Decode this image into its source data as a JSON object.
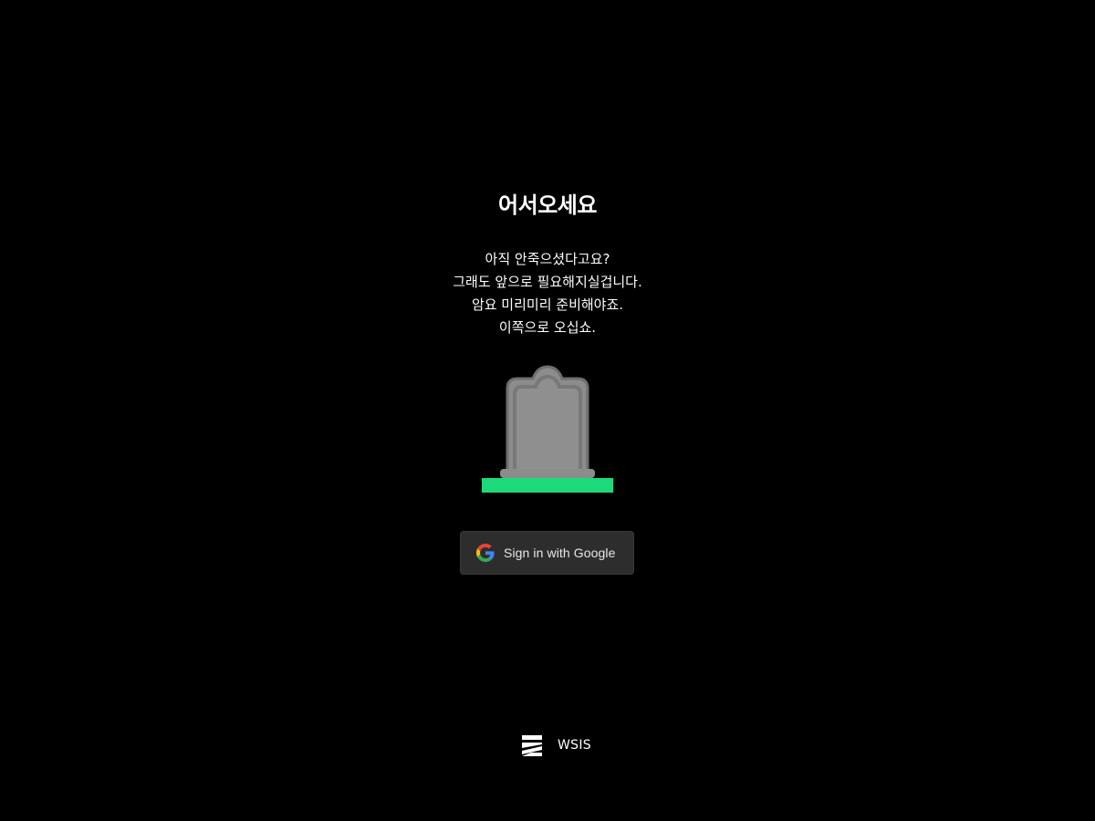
{
  "welcome": {
    "title": "어서오세요",
    "lines": [
      "아직 안죽으셨다고요?",
      "그래도 앞으로 필요해지실겁니다.",
      "암요 미리미리 준비해야죠.",
      "이쪽으로 오십쇼."
    ]
  },
  "illustration": {
    "icon": "tombstone-icon",
    "stone_color": "#8c8c8c",
    "stone_border_color": "#6e6e6e",
    "ground_color": "#1ed97a"
  },
  "signin": {
    "label": "Sign in with Google",
    "icon": "google-icon",
    "background": "#2d2d2d"
  },
  "footer": {
    "brand": "WSIS",
    "icon": "wsis-logo-icon"
  }
}
